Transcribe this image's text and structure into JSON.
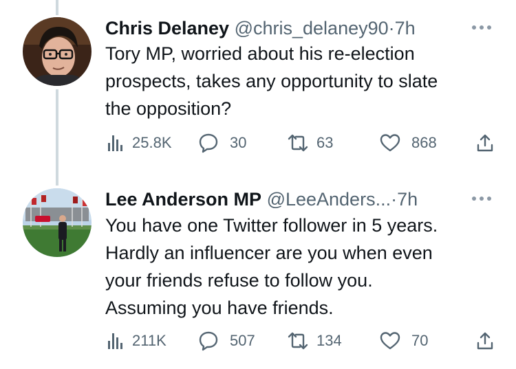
{
  "tweets": [
    {
      "author_name": "Chris Delaney",
      "handle": "@chris_delaney90",
      "separator": "·",
      "time": "7h",
      "text_lines": [
        "Tory MP, worried about his re-election",
        "prospects, takes any opportunity to slate",
        "the opposition?"
      ],
      "views": "25.8K",
      "replies": "30",
      "retweets": "63",
      "likes": "868"
    },
    {
      "author_name": "Lee Anderson MP",
      "handle": "@LeeAnders...",
      "separator": "·",
      "time": "7h",
      "text_lines": [
        "You have one Twitter follower in 5 years.",
        "Hardly an influencer are you when even",
        "your friends refuse to follow you.",
        "Assuming you have friends."
      ],
      "views": "211K",
      "replies": "507",
      "retweets": "134",
      "likes": "70"
    }
  ],
  "colors": {
    "text": "#0f1419",
    "secondary": "#536471",
    "thread_line": "#cfd9de"
  },
  "icons": [
    "views-icon",
    "reply-icon",
    "retweet-icon",
    "like-icon",
    "share-icon",
    "more-icon"
  ]
}
